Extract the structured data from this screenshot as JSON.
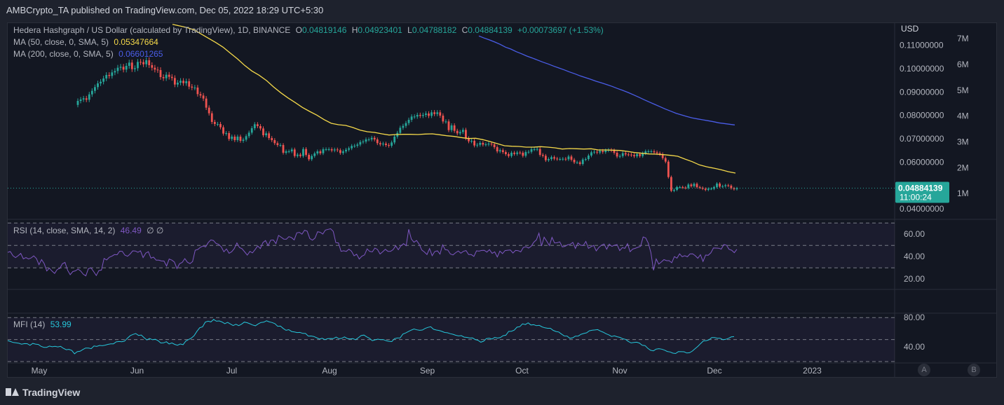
{
  "header": {
    "published": "AMBCrypto_TA published on TradingView.com, Dec 05, 2022 18:29 UTC+5:30"
  },
  "legend": {
    "symbol": "Hedera Hashgraph / US Dollar (calculated by TradingView), 1D, BINANCE",
    "o_label": "O",
    "o": "0.04819146",
    "h_label": "H",
    "h": "0.04923401",
    "l_label": "L",
    "l": "0.04788182",
    "c_label": "C",
    "c": "0.04884139",
    "change": "+0.00073697 (+1.53%)",
    "ma50_label": "MA (50, close, 0, SMA, 5)",
    "ma50": "0.05347664",
    "ma200_label": "MA (200, close, 0, SMA, 5)",
    "ma200": "0.06601265",
    "rsi_label": "RSI (14, close, SMA, 14, 2)",
    "rsi": "46.49",
    "rsi_extra": "∅ ∅",
    "mfi_label": "MFI (14)",
    "mfi": "53.99"
  },
  "price_axis": {
    "currency": "USD",
    "price_ticks": [
      "0.11000000",
      "0.10000000",
      "0.09000000",
      "0.08000000",
      "0.07000000",
      "0.06000000",
      "0.04000000"
    ],
    "volume_ticks": [
      "7M",
      "6M",
      "5M",
      "4M",
      "3M",
      "2M",
      "1M"
    ],
    "last_price": "0.04884139",
    "countdown": "11:00:24",
    "rsi_ticks": [
      "60.00",
      "40.00",
      "20.00"
    ],
    "mfi_ticks": [
      "80.00",
      "40.00"
    ]
  },
  "time_axis": [
    "May",
    "Jun",
    "Jul",
    "Aug",
    "Sep",
    "Oct",
    "Nov",
    "Dec",
    "2023"
  ],
  "buttons": {
    "a": "A",
    "b": "B"
  },
  "footer": {
    "brand": "TradingView"
  },
  "colors": {
    "up": "#26a69a",
    "down": "#ef5350",
    "ma50": "#f5d94a",
    "ma200": "#4a5de8",
    "rsi": "#7e57c2",
    "mfi": "#26c6da",
    "bg": "#131722"
  },
  "chart_data": [
    {
      "type": "candlestick",
      "title": "Hedera Hashgraph / US Dollar (calculated by TradingView), 1D, BINANCE",
      "ylabel": "USD",
      "ylim": [
        0.0355,
        0.1195
      ],
      "x_start": "2022-05-01",
      "x_end": "2022-12-05",
      "close": [
        0.0862,
        0.0868,
        0.0873,
        0.0867,
        0.089,
        0.0905,
        0.0921,
        0.0937,
        0.0944,
        0.0958,
        0.0973,
        0.0969,
        0.0984,
        0.099,
        0.1004,
        0.1008,
        0.0996,
        0.1012,
        0.1026,
        0.0998,
        0.1002,
        0.1029,
        0.1028,
        0.1019,
        0.1036,
        0.1015,
        0.1004,
        0.0996,
        0.0994,
        0.0964,
        0.0959,
        0.0974,
        0.0965,
        0.096,
        0.0932,
        0.094,
        0.0948,
        0.0938,
        0.0946,
        0.0923,
        0.0919,
        0.0919,
        0.0891,
        0.0885,
        0.0872,
        0.0833,
        0.0809,
        0.0772,
        0.0763,
        0.0763,
        0.0749,
        0.0722,
        0.0724,
        0.0699,
        0.0709,
        0.0694,
        0.0709,
        0.0691,
        0.0696,
        0.0711,
        0.0726,
        0.0745,
        0.0762,
        0.0754,
        0.0744,
        0.0715,
        0.0723,
        0.0703,
        0.0694,
        0.0681,
        0.0673,
        0.0673,
        0.064,
        0.0646,
        0.0646,
        0.0654,
        0.0626,
        0.0632,
        0.0626,
        0.0656,
        0.0631,
        0.0612,
        0.0626,
        0.0637,
        0.0646,
        0.0638,
        0.0655,
        0.0655,
        0.0655,
        0.065,
        0.0654,
        0.0651,
        0.0639,
        0.0646,
        0.0653,
        0.0659,
        0.0669,
        0.067,
        0.0675,
        0.0686,
        0.0688,
        0.0697,
        0.0697,
        0.0704,
        0.0697,
        0.0681,
        0.0676,
        0.0679,
        0.0673,
        0.067,
        0.0684,
        0.0709,
        0.0725,
        0.0747,
        0.0755,
        0.0767,
        0.0781,
        0.0795,
        0.0795,
        0.0802,
        0.0798,
        0.0802,
        0.0808,
        0.0798,
        0.0813,
        0.0806,
        0.0813,
        0.0799,
        0.0774,
        0.0774,
        0.0737,
        0.0757,
        0.0734,
        0.0723,
        0.0729,
        0.0738,
        0.0702,
        0.0689,
        0.0691,
        0.0671,
        0.0674,
        0.0682,
        0.0675,
        0.0676,
        0.0679,
        0.0676,
        0.0664,
        0.0646,
        0.0651,
        0.0643,
        0.0634,
        0.0626,
        0.064,
        0.0635,
        0.0641,
        0.064,
        0.0627,
        0.0643,
        0.0644,
        0.0655,
        0.0655,
        0.0656,
        0.0631,
        0.0627,
        0.0608,
        0.0613,
        0.0621,
        0.0615,
        0.0613,
        0.0613,
        0.0614,
        0.0612,
        0.0624,
        0.061,
        0.0599,
        0.0599,
        0.0592,
        0.0611,
        0.0613,
        0.0628,
        0.0642,
        0.0644,
        0.0641,
        0.0648,
        0.0643,
        0.065,
        0.0652,
        0.065,
        0.064,
        0.0624,
        0.0626,
        0.0638,
        0.0633,
        0.0632,
        0.063,
        0.0625,
        0.0634,
        0.0626,
        0.0638,
        0.0646,
        0.0646,
        0.0646,
        0.0642,
        0.0638,
        0.0634,
        0.0617,
        0.0602,
        0.0536,
        0.0477,
        0.0481,
        0.0493,
        0.0493,
        0.0491,
        0.0489,
        0.0504,
        0.0497,
        0.0507,
        0.0493,
        0.049,
        0.0486,
        0.0481,
        0.0486,
        0.0486,
        0.0493,
        0.0508,
        0.0495,
        0.0497,
        0.0501,
        0.0499,
        0.0488,
        0.0484,
        0.0488
      ],
      "ma50": [
        0.119,
        0.1183,
        0.1176,
        0.1166,
        0.1148,
        0.113,
        0.1112,
        0.1092,
        0.1067,
        0.1042,
        0.1014,
        0.099,
        0.0972,
        0.095,
        0.0922,
        0.0897,
        0.0875,
        0.0855,
        0.0834,
        0.0817,
        0.0801,
        0.0782,
        0.0766,
        0.076,
        0.0757,
        0.0748,
        0.0737,
        0.073,
        0.0727,
        0.0721,
        0.0716,
        0.0718,
        0.0719,
        0.0719,
        0.0718,
        0.072,
        0.0721,
        0.0717,
        0.0713,
        0.071,
        0.0705,
        0.0701,
        0.0702,
        0.0696,
        0.0688,
        0.0679,
        0.067,
        0.0668,
        0.0667,
        0.0664,
        0.0664,
        0.0666,
        0.0664,
        0.0661,
        0.0656,
        0.0658,
        0.0657,
        0.0656,
        0.0657,
        0.0652,
        0.0652,
        0.0651,
        0.065,
        0.0646,
        0.0641,
        0.0638,
        0.0635,
        0.0634,
        0.0632,
        0.0629,
        0.0625,
        0.0613,
        0.0602,
        0.0588,
        0.058,
        0.0574,
        0.0567,
        0.0559,
        0.0553
      ],
      "ma200": [
        0.114,
        0.1131,
        0.1123,
        0.1114,
        0.1104,
        0.1092,
        0.1084,
        0.1073,
        0.1064,
        0.1054,
        0.1046,
        0.1037,
        0.1028,
        0.102,
        0.1011,
        0.1003,
        0.0995,
        0.0986,
        0.0978,
        0.0969,
        0.0962,
        0.0954,
        0.0946,
        0.0939,
        0.0932,
        0.0924,
        0.0915,
        0.0907,
        0.0898,
        0.0888,
        0.0878,
        0.0867,
        0.0857,
        0.0847,
        0.0837,
        0.0827,
        0.0818,
        0.0809,
        0.0802,
        0.0795,
        0.0789,
        0.0785,
        0.0781,
        0.0777,
        0.0773,
        0.0768,
        0.0765,
        0.0762,
        0.0759
      ],
      "last_close": 0.04884139,
      "volume_axis_ticks": [
        7,
        6,
        5,
        4,
        3,
        2,
        1
      ]
    },
    {
      "type": "line",
      "title": "RSI (14, close, SMA, 14, 2)",
      "ylim": [
        12,
        72
      ],
      "bands": [
        30,
        50,
        70
      ],
      "values": [
        43.8,
        44.5,
        40.8,
        39.1,
        40.8,
        42.8,
        38.0,
        39.1,
        37.9,
        38.8,
        40.6,
        38.3,
        32.8,
        37.3,
        33.8,
        27.2,
        29.7,
        27.1,
        25.0,
        28.5,
        29.5,
        33.6,
        34.8,
        27.9,
        23.9,
        26.7,
        27.3,
        28.8,
        27.2,
        24.3,
        22.8,
        29.3,
        29.9,
        26.6,
        23.1,
        27.5,
        28.0,
        38.3,
        37.0,
        39.4,
        40.4,
        41.8,
        41.6,
        44.8,
        44.7,
        41.3,
        40.3,
        42.3,
        45.1,
        45.0,
        43.8,
        45.1,
        39.1,
        43.1,
        44.4,
        38.6,
        39.5,
        36.8,
        36.8,
        36.1,
        36.0,
        31.6,
        37.8,
        36.9,
        35.1,
        29.3,
        33.6,
        34.8,
        38.2,
        35.0,
        33.7,
        35.6,
        45.7,
        46.4,
        48.3,
        49.5,
        48.6,
        52.5,
        54.9,
        54.4,
        51.8,
        50.9,
        48.7,
        44.3,
        46.8,
        43.0,
        44.3,
        47.1,
        52.2,
        48.1,
        47.0,
        44.2,
        41.3,
        44.6,
        43.3,
        46.3,
        49.5,
        47.2,
        52.5,
        54.3,
        49.8,
        54.6,
        54.8,
        51.6,
        58.9,
        57.3,
        55.6,
        55.5,
        57.8,
        56.9,
        54.9,
        61.2,
        61.6,
        60.0,
        63.5,
        62.7,
        56.1,
        54.6,
        56.5,
        62.2,
        61.7,
        60.1,
        63.6,
        64.3,
        64.8,
        62.5,
        52.5,
        52.2,
        44.7,
        45.2,
        44.6,
        46.6,
        44.8,
        40.7,
        42.1,
        37.9,
        40.3,
        41.5,
        46.9,
        44.6,
        44.2,
        47.6,
        46.3,
        42.3,
        44.4,
        46.5,
        44.7,
        44.6,
        46.2,
        49.6,
        46.1,
        49.7,
        51.5,
        49.7,
        64.4,
        55.6,
        52.8,
        54.4,
        51.0,
        45.9,
        44.1,
        41.9,
        47.2,
        40.8,
        44.5,
        45.1,
        42.2,
        50.5,
        46.2,
        45.8,
        42.3,
        41.5,
        43.5,
        45.0,
        43.0,
        44.7,
        45.4,
        41.8,
        41.8,
        40.2,
        45.1,
        44.9,
        45.5,
        45.6,
        44.0,
        46.2,
        42.9,
        44.2,
        39.7,
        44.9,
        42.7,
        45.4,
        45.7,
        45.9,
        43.2,
        45.5,
        45.3,
        44.2,
        48.1,
        48.8,
        47.6,
        49.2,
        52.8,
        54.9,
        60.9,
        49.5,
        57.3,
        53.6,
        49.9,
        57.1,
        52.2,
        52.4,
        53.1,
        48.6,
        49.2,
        50.5,
        50.9,
        52.7,
        47.3,
        52.2,
        50.1,
        49.9,
        53.5,
        47.4,
        48.8,
        50.0,
        45.1,
        48.1,
        50.2,
        51.2,
        46.6,
        51.1,
        49.1,
        50.1,
        50.7,
        45.4,
        48.0,
        47.4,
        51.5,
        44.4,
        46.7,
        47.4,
        48.3,
        49.1,
        57.5,
        56.6,
        51.9,
        43.5,
        27.8,
        37.9,
        33.3,
        35.2,
        37.3,
        36.4,
        36.4,
        34.5,
        40.0,
        38.6,
        42.5,
        39.9,
        40.8,
        39.8,
        42.4,
        42.5,
        40.8,
        38.5,
        41.7,
        35.7,
        41.4,
        41.2,
        43.4,
        47.7,
        47.6,
        47.5,
        46.7,
        50.7,
        50.2,
        46.5,
        45.7,
        43.5,
        46.5
      ],
      "last": 46.49
    },
    {
      "type": "area",
      "title": "MFI (14)",
      "ylim": [
        20,
        84
      ],
      "bands": [
        20,
        50,
        80
      ],
      "values": [
        48.6,
        47.3,
        46.0,
        45.5,
        44.9,
        43.7,
        44.5,
        44.4,
        42.2,
        44.7,
        43.8,
        43.3,
        40.7,
        39.4,
        39.4,
        41.1,
        40.2,
        40.7,
        40.0,
        40.7,
        38.1,
        36.1,
        36.6,
        35.3,
        30.6,
        33.5,
        34.0,
        36.4,
        38.4,
        38.4,
        37.6,
        41.2,
        40.6,
        42.0,
        41.6,
        42.4,
        43.4,
        44.2,
        44.2,
        46.8,
        47.3,
        47.0,
        47.9,
        51.8,
        55.2,
        57.0,
        58.2,
        55.6,
        56.2,
        52.6,
        49.4,
        51.4,
        49.7,
        50.4,
        48.6,
        45.3,
        45.5,
        47.0,
        44.0,
        45.4,
        43.4,
        42.3,
        44.0,
        43.0,
        47.9,
        50.0,
        52.0,
        55.3,
        61.3,
        66.1,
        67.3,
        73.8,
        75.0,
        74.1,
        77.4,
        75.0,
        75.4,
        74.0,
        71.7,
        73.4,
        71.3,
        69.1,
        70.8,
        69.0,
        70.9,
        73.8,
        73.0,
        71.6,
        69.9,
        68.8,
        71.3,
        73.3,
        73.7,
        75.6,
        74.1,
        73.2,
        71.7,
        68.1,
        68.3,
        65.1,
        62.6,
        63.5,
        61.0,
        60.4,
        59.5,
        59.7,
        58.4,
        58.3,
        54.8,
        54.9,
        54.2,
        52.5,
        50.8,
        51.7,
        49.9,
        51.2,
        51.4,
        51.2,
        53.3,
        51.1,
        51.6,
        53.6,
        51.4,
        50.9,
        51.2,
        49.8,
        52.5,
        55.4,
        56.1,
        53.7,
        51.7,
        48.5,
        49.6,
        50.6,
        49.8,
        49.9,
        48.4,
        47.6,
        47.2,
        51.2,
        52.1,
        52.2,
        57.4,
        59.0,
        61.0,
        62.9,
        64.4,
        63.3,
        62.6,
        63.0,
        65.2,
        66.6,
        67.5,
        64.0,
        63.0,
        62.4,
        61.2,
        59.6,
        59.3,
        58.0,
        57.2,
        55.8,
        55.0,
        55.3,
        53.3,
        53.0,
        52.1,
        52.2,
        50.0,
        48.9,
        46.4,
        47.8,
        51.3,
        51.9,
        50.7,
        53.0,
        52.0,
        52.7,
        55.2,
        55.9,
        61.1,
        61.4,
        62.8,
        66.9,
        67.6,
        71.4,
        70.4,
        72.8,
        69.9,
        70.2,
        68.9,
        69.4,
        67.3,
        66.0,
        65.4,
        65.4,
        62.5,
        61.0,
        60.3,
        57.4,
        54.9,
        54.8,
        51.7,
        52.4,
        54.7,
        54.8,
        57.2,
        58.3,
        59.2,
        61.9,
        62.8,
        63.1,
        63.6,
        61.5,
        60.0,
        57.9,
        56.4,
        54.2,
        55.1,
        53.8,
        53.0,
        51.1,
        50.3,
        47.4,
        45.4,
        46.1,
        46.4,
        45.2,
        42.2,
        41.8,
        38.1,
        35.4,
        34.6,
        37.0,
        37.6,
        36.9,
        35.6,
        33.8,
        33.1,
        31.5,
        31.0,
        33.6,
        33.5,
        33.4,
        31.7,
        32.0,
        34.3,
        37.6,
        40.8,
        44.6,
        48.2,
        48.5,
        49.7,
        52.8,
        52.7,
        51.8,
        51.8,
        49.8,
        50.3,
        51.7,
        53.6,
        53.99
      ],
      "last": 53.99
    }
  ]
}
